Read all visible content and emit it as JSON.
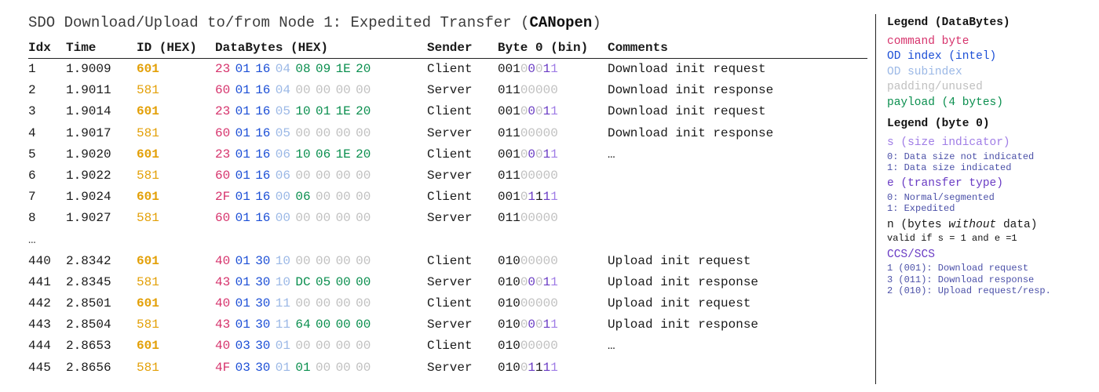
{
  "title": {
    "prefix": "SDO Download/Upload to/from Node 1: Expedited Transfer (",
    "bold": "CANopen",
    "suffix": ")"
  },
  "columns": {
    "idx": "Idx",
    "time": "Time",
    "id": "ID (HEX)",
    "data": "DataBytes (HEX)",
    "sender": "Sender",
    "b0": "Byte 0 (bin)",
    "comments": "Comments"
  },
  "ellipsis": "…",
  "rows": [
    {
      "idx": "1",
      "time": "1.9009",
      "id": "601",
      "id_role": "client",
      "bytes": [
        [
          "23",
          "cmd"
        ],
        [
          "01",
          "idx"
        ],
        [
          "16",
          "idx"
        ],
        [
          "04",
          "sub"
        ],
        [
          "08",
          "pay"
        ],
        [
          "09",
          "pay"
        ],
        [
          "1E",
          "pay"
        ],
        [
          "20",
          "pay"
        ]
      ],
      "sender": "Client",
      "b0": [
        [
          "001",
          "ccs"
        ],
        [
          "0",
          "n"
        ],
        [
          "0",
          "e"
        ],
        [
          "0",
          "n"
        ],
        [
          "1",
          "e"
        ],
        [
          "1",
          "s"
        ]
      ],
      "comment": "Download init request"
    },
    {
      "idx": "2",
      "time": "1.9011",
      "id": "581",
      "id_role": "server",
      "bytes": [
        [
          "60",
          "cmd"
        ],
        [
          "01",
          "idx"
        ],
        [
          "16",
          "idx"
        ],
        [
          "04",
          "sub"
        ],
        [
          "00",
          "pad"
        ],
        [
          "00",
          "pad"
        ],
        [
          "00",
          "pad"
        ],
        [
          "00",
          "pad"
        ]
      ],
      "sender": "Server",
      "b0": [
        [
          "011",
          "ccs"
        ],
        [
          "0",
          "n"
        ],
        [
          "0",
          "n"
        ],
        [
          "0",
          "n"
        ],
        [
          "0",
          "n"
        ],
        [
          "0",
          "n"
        ]
      ],
      "comment": "Download init response"
    },
    {
      "idx": "3",
      "time": "1.9014",
      "id": "601",
      "id_role": "client",
      "bytes": [
        [
          "23",
          "cmd"
        ],
        [
          "01",
          "idx"
        ],
        [
          "16",
          "idx"
        ],
        [
          "05",
          "sub"
        ],
        [
          "10",
          "pay"
        ],
        [
          "01",
          "pay"
        ],
        [
          "1E",
          "pay"
        ],
        [
          "20",
          "pay"
        ]
      ],
      "sender": "Client",
      "b0": [
        [
          "001",
          "ccs"
        ],
        [
          "0",
          "n"
        ],
        [
          "0",
          "e"
        ],
        [
          "0",
          "n"
        ],
        [
          "1",
          "e"
        ],
        [
          "1",
          "s"
        ]
      ],
      "comment": "Download init request"
    },
    {
      "idx": "4",
      "time": "1.9017",
      "id": "581",
      "id_role": "server",
      "bytes": [
        [
          "60",
          "cmd"
        ],
        [
          "01",
          "idx"
        ],
        [
          "16",
          "idx"
        ],
        [
          "05",
          "sub"
        ],
        [
          "00",
          "pad"
        ],
        [
          "00",
          "pad"
        ],
        [
          "00",
          "pad"
        ],
        [
          "00",
          "pad"
        ]
      ],
      "sender": "Server",
      "b0": [
        [
          "011",
          "ccs"
        ],
        [
          "0",
          "n"
        ],
        [
          "0",
          "n"
        ],
        [
          "0",
          "n"
        ],
        [
          "0",
          "n"
        ],
        [
          "0",
          "n"
        ]
      ],
      "comment": "Download init response"
    },
    {
      "idx": "5",
      "time": "1.9020",
      "id": "601",
      "id_role": "client",
      "bytes": [
        [
          "23",
          "cmd"
        ],
        [
          "01",
          "idx"
        ],
        [
          "16",
          "idx"
        ],
        [
          "06",
          "sub"
        ],
        [
          "10",
          "pay"
        ],
        [
          "06",
          "pay"
        ],
        [
          "1E",
          "pay"
        ],
        [
          "20",
          "pay"
        ]
      ],
      "sender": "Client",
      "b0": [
        [
          "001",
          "ccs"
        ],
        [
          "0",
          "n"
        ],
        [
          "0",
          "e"
        ],
        [
          "0",
          "n"
        ],
        [
          "1",
          "e"
        ],
        [
          "1",
          "s"
        ]
      ],
      "comment": "…"
    },
    {
      "idx": "6",
      "time": "1.9022",
      "id": "581",
      "id_role": "server",
      "bytes": [
        [
          "60",
          "cmd"
        ],
        [
          "01",
          "idx"
        ],
        [
          "16",
          "idx"
        ],
        [
          "06",
          "sub"
        ],
        [
          "00",
          "pad"
        ],
        [
          "00",
          "pad"
        ],
        [
          "00",
          "pad"
        ],
        [
          "00",
          "pad"
        ]
      ],
      "sender": "Server",
      "b0": [
        [
          "011",
          "ccs"
        ],
        [
          "0",
          "n"
        ],
        [
          "0",
          "n"
        ],
        [
          "0",
          "n"
        ],
        [
          "0",
          "n"
        ],
        [
          "0",
          "n"
        ]
      ],
      "comment": ""
    },
    {
      "idx": "7",
      "time": "1.9024",
      "id": "601",
      "id_role": "client",
      "bytes": [
        [
          "2F",
          "cmd"
        ],
        [
          "01",
          "idx"
        ],
        [
          "16",
          "idx"
        ],
        [
          "00",
          "sub"
        ],
        [
          "06",
          "pay"
        ],
        [
          "00",
          "pad"
        ],
        [
          "00",
          "pad"
        ],
        [
          "00",
          "pad"
        ]
      ],
      "sender": "Client",
      "b0": [
        [
          "001",
          "ccs"
        ],
        [
          "0",
          "n"
        ],
        [
          "1",
          "e"
        ],
        [
          "1",
          "ccs"
        ],
        [
          "1",
          "e"
        ],
        [
          "1",
          "s"
        ]
      ],
      "comment": ""
    },
    {
      "idx": "8",
      "time": "1.9027",
      "id": "581",
      "id_role": "server",
      "bytes": [
        [
          "60",
          "cmd"
        ],
        [
          "01",
          "idx"
        ],
        [
          "16",
          "idx"
        ],
        [
          "00",
          "sub"
        ],
        [
          "00",
          "pad"
        ],
        [
          "00",
          "pad"
        ],
        [
          "00",
          "pad"
        ],
        [
          "00",
          "pad"
        ]
      ],
      "sender": "Server",
      "b0": [
        [
          "011",
          "ccs"
        ],
        [
          "0",
          "n"
        ],
        [
          "0",
          "n"
        ],
        [
          "0",
          "n"
        ],
        [
          "0",
          "n"
        ],
        [
          "0",
          "n"
        ]
      ],
      "comment": ""
    },
    {
      "break": true
    },
    {
      "idx": "440",
      "time": "2.8342",
      "id": "601",
      "id_role": "client",
      "bytes": [
        [
          "40",
          "cmd"
        ],
        [
          "01",
          "idx"
        ],
        [
          "30",
          "idx"
        ],
        [
          "10",
          "sub"
        ],
        [
          "00",
          "pad"
        ],
        [
          "00",
          "pad"
        ],
        [
          "00",
          "pad"
        ],
        [
          "00",
          "pad"
        ]
      ],
      "sender": "Client",
      "b0": [
        [
          "010",
          "ccs"
        ],
        [
          "0",
          "n"
        ],
        [
          "0",
          "n"
        ],
        [
          "0",
          "n"
        ],
        [
          "0",
          "n"
        ],
        [
          "0",
          "n"
        ]
      ],
      "comment": "Upload init request"
    },
    {
      "idx": "441",
      "time": "2.8345",
      "id": "581",
      "id_role": "server",
      "bytes": [
        [
          "43",
          "cmd"
        ],
        [
          "01",
          "idx"
        ],
        [
          "30",
          "idx"
        ],
        [
          "10",
          "sub"
        ],
        [
          "DC",
          "pay"
        ],
        [
          "05",
          "pay"
        ],
        [
          "00",
          "pay"
        ],
        [
          "00",
          "pay"
        ]
      ],
      "sender": "Server",
      "b0": [
        [
          "010",
          "ccs"
        ],
        [
          "0",
          "n"
        ],
        [
          "0",
          "e"
        ],
        [
          "0",
          "n"
        ],
        [
          "1",
          "e"
        ],
        [
          "1",
          "s"
        ]
      ],
      "comment": "Upload init response"
    },
    {
      "idx": "442",
      "time": "2.8501",
      "id": "601",
      "id_role": "client",
      "bytes": [
        [
          "40",
          "cmd"
        ],
        [
          "01",
          "idx"
        ],
        [
          "30",
          "idx"
        ],
        [
          "11",
          "sub"
        ],
        [
          "00",
          "pad"
        ],
        [
          "00",
          "pad"
        ],
        [
          "00",
          "pad"
        ],
        [
          "00",
          "pad"
        ]
      ],
      "sender": "Client",
      "b0": [
        [
          "010",
          "ccs"
        ],
        [
          "0",
          "n"
        ],
        [
          "0",
          "n"
        ],
        [
          "0",
          "n"
        ],
        [
          "0",
          "n"
        ],
        [
          "0",
          "n"
        ]
      ],
      "comment": "Upload init request"
    },
    {
      "idx": "443",
      "time": "2.8504",
      "id": "581",
      "id_role": "server",
      "bytes": [
        [
          "43",
          "cmd"
        ],
        [
          "01",
          "idx"
        ],
        [
          "30",
          "idx"
        ],
        [
          "11",
          "sub"
        ],
        [
          "64",
          "pay"
        ],
        [
          "00",
          "pay"
        ],
        [
          "00",
          "pay"
        ],
        [
          "00",
          "pay"
        ]
      ],
      "sender": "Server",
      "b0": [
        [
          "010",
          "ccs"
        ],
        [
          "0",
          "n"
        ],
        [
          "0",
          "e"
        ],
        [
          "0",
          "n"
        ],
        [
          "1",
          "e"
        ],
        [
          "1",
          "s"
        ]
      ],
      "comment": "Upload init response"
    },
    {
      "idx": "444",
      "time": "2.8653",
      "id": "601",
      "id_role": "client",
      "bytes": [
        [
          "40",
          "cmd"
        ],
        [
          "03",
          "idx"
        ],
        [
          "30",
          "idx"
        ],
        [
          "01",
          "sub"
        ],
        [
          "00",
          "pad"
        ],
        [
          "00",
          "pad"
        ],
        [
          "00",
          "pad"
        ],
        [
          "00",
          "pad"
        ]
      ],
      "sender": "Client",
      "b0": [
        [
          "010",
          "ccs"
        ],
        [
          "0",
          "n"
        ],
        [
          "0",
          "n"
        ],
        [
          "0",
          "n"
        ],
        [
          "0",
          "n"
        ],
        [
          "0",
          "n"
        ]
      ],
      "comment": "…"
    },
    {
      "idx": "445",
      "time": "2.8656",
      "id": "581",
      "id_role": "server",
      "bytes": [
        [
          "4F",
          "cmd"
        ],
        [
          "03",
          "idx"
        ],
        [
          "30",
          "idx"
        ],
        [
          "01",
          "sub"
        ],
        [
          "01",
          "pay"
        ],
        [
          "00",
          "pad"
        ],
        [
          "00",
          "pad"
        ],
        [
          "00",
          "pad"
        ]
      ],
      "sender": "Server",
      "b0": [
        [
          "010",
          "ccs"
        ],
        [
          "0",
          "n"
        ],
        [
          "1",
          "e"
        ],
        [
          "1",
          "ccs"
        ],
        [
          "1",
          "e"
        ],
        [
          "1",
          "s"
        ]
      ],
      "comment": ""
    }
  ],
  "legend": {
    "databytes_title": "Legend (DataBytes)",
    "cmd": "command byte",
    "index": "OD index (intel)",
    "sub": "OD subindex",
    "pad": "padding/unused",
    "pay": "payload (4 bytes)",
    "byte0_title": "Legend (byte 0)",
    "s_label": "s (size indicator)",
    "s_0": "0: Data size not indicated",
    "s_1": "1: Data size indicated",
    "e_label": "e (transfer type)",
    "e_0": "0: Normal/segmented",
    "e_1": "1: Expedited",
    "n_prefix": "n (bytes ",
    "n_italic": "without",
    "n_suffix": " data)",
    "n_sub": "valid if s = 1 and e =1",
    "ccs_label": "CCS/SCS",
    "ccs_1": "1 (001): Download request",
    "ccs_3": "3 (011): Download response",
    "ccs_2": "2 (010): Upload request/resp."
  }
}
